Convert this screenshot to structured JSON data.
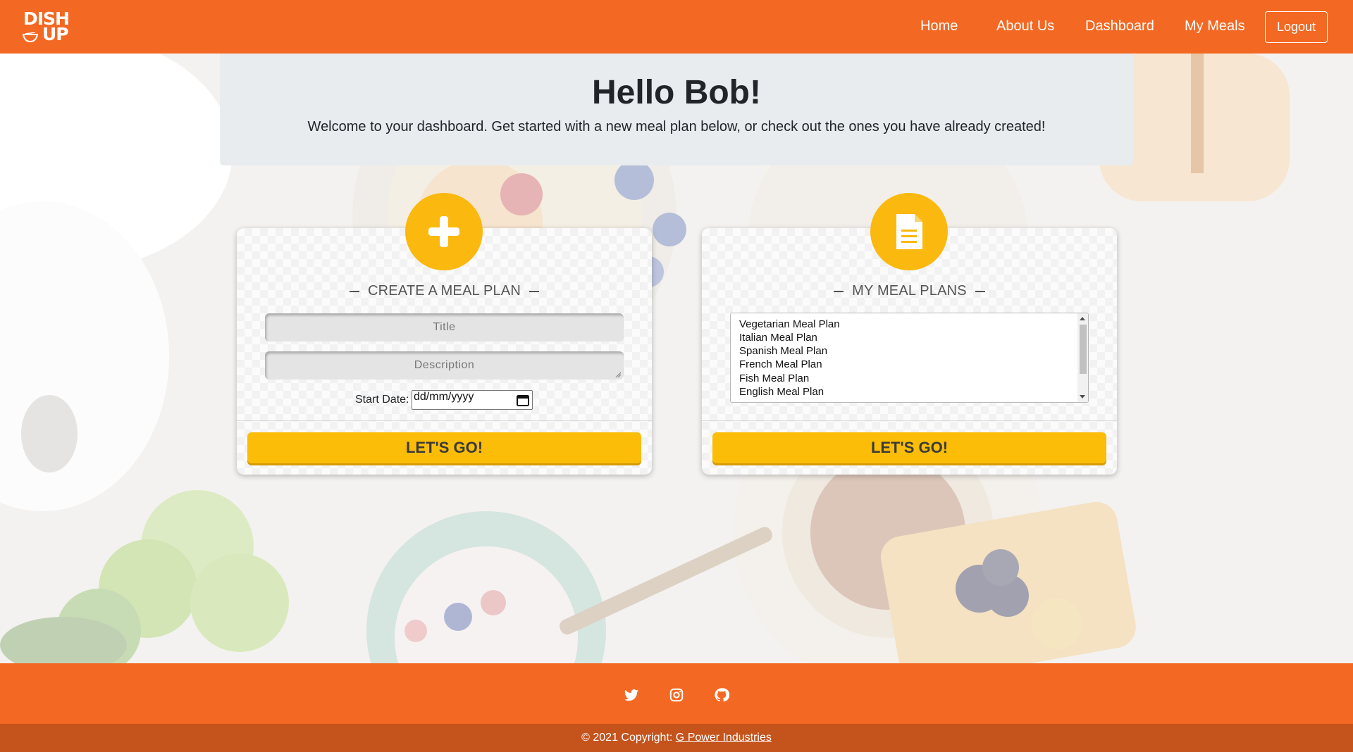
{
  "nav": {
    "logo_line1": "DISH",
    "logo_line2": "UP",
    "links": [
      "Home",
      "About Us",
      "Dashboard",
      "My Meals"
    ],
    "logout_label": "Logout"
  },
  "welcome": {
    "heading": "Hello Bob!",
    "text": "Welcome to your dashboard. Get started with a new meal plan below, or check out the ones you have already created!"
  },
  "create_card": {
    "icon": "plus-icon",
    "title": "CREATE A MEAL PLAN",
    "title_placeholder": "Title",
    "description_placeholder": "Description",
    "start_date_label": "Start Date:",
    "date_value": "dd/mm/yyyy",
    "button_label": "LET'S GO!"
  },
  "plans_card": {
    "icon": "document-icon",
    "title": "MY MEAL PLANS",
    "plans": [
      "Vegetarian Meal Plan",
      "Italian Meal Plan",
      "Spanish Meal Plan",
      "French Meal Plan",
      "Fish Meal Plan",
      "English Meal Plan"
    ],
    "button_label": "LET'S GO!"
  },
  "footer": {
    "social_icons": [
      "twitter-icon",
      "instagram-icon",
      "github-icon"
    ],
    "copyright_prefix": "© 2021 Copyright:",
    "copyright_link": "G Power Industries"
  },
  "colors": {
    "primary_orange": "#f36823",
    "dark_orange": "#c4531c",
    "accent_yellow": "#fbbd08",
    "panel_grey": "#e9ecef"
  }
}
